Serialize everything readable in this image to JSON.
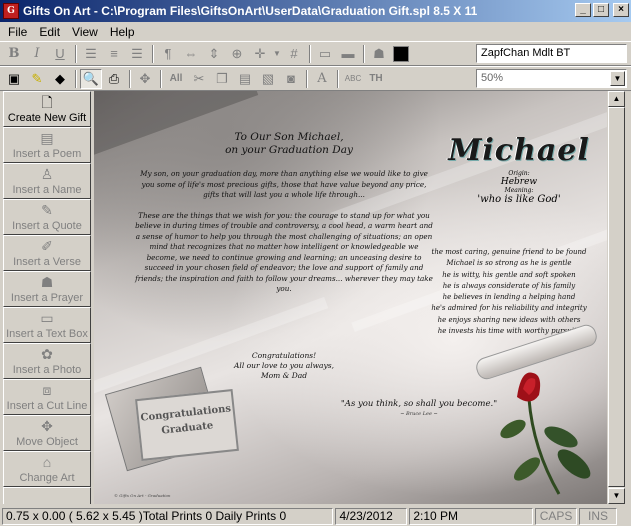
{
  "window": {
    "title": "Gifts On Art - C:\\Program Files\\GiftsOnArt\\UserData\\Graduation Gift.spl 8.5 X 11",
    "app_icon_letter": "G",
    "minimize": "_",
    "maximize": "□",
    "close": "×"
  },
  "menu": [
    "File",
    "Edit",
    "View",
    "Help"
  ],
  "toolbar": {
    "font_name": "ZapfChan Mdlt BT",
    "zoom": "50%"
  },
  "sidebar": [
    {
      "label": "Create New Gift",
      "icon": "new-document-icon",
      "glyph": "🗋",
      "enabled": true
    },
    {
      "label": "Insert a Poem",
      "icon": "poem-icon",
      "glyph": "▤",
      "enabled": false
    },
    {
      "label": "Insert a Name",
      "icon": "person-icon",
      "glyph": "♙",
      "enabled": false
    },
    {
      "label": "Insert a Quote",
      "icon": "quote-icon",
      "glyph": "✎",
      "enabled": false
    },
    {
      "label": "Insert a Verse",
      "icon": "verse-icon",
      "glyph": "✐",
      "enabled": false
    },
    {
      "label": "Insert a Prayer",
      "icon": "prayer-icon",
      "glyph": "☗",
      "enabled": false
    },
    {
      "label": "Insert a Text Box",
      "icon": "textbox-icon",
      "glyph": "▭",
      "enabled": false
    },
    {
      "label": "Insert a Photo",
      "icon": "photo-icon",
      "glyph": "✿",
      "enabled": false
    },
    {
      "label": "Insert a Cut Line",
      "icon": "cut-line-icon",
      "glyph": "⧈",
      "enabled": false
    },
    {
      "label": "Move Object",
      "icon": "move-icon",
      "glyph": "✥",
      "enabled": false
    },
    {
      "label": "Change Art",
      "icon": "art-icon",
      "glyph": "⌂",
      "enabled": false
    },
    {
      "label": "",
      "icon": "more-icon",
      "glyph": "✂",
      "enabled": false
    }
  ],
  "canvas": {
    "poem_title": [
      "To Our Son Michael,",
      "on your Graduation Day"
    ],
    "poem_paragraphs": [
      "My son, on your graduation day, more than anything else we would like to give you some of life's most precious gifts, those that have value beyond any price, gifts that will last you a whole life through...",
      "These are the things that we wish for you: the courage to stand up for what you believe in during times of trouble and controversy, a cool head, a warm heart and a sense of humor to help you through the most challenging of situations; an open mind that recognizes that no matter how intelligent or knowledgeable we become, we need to continue growing and learning; an unceasing desire to succeed in your chosen field of endeavor; the love and support of family and friends; the inspiration and faith to follow your dreams... wherever they may take you."
    ],
    "poem_closing": [
      "Congratulations!",
      "All our love to you always,",
      "Mom & Dad"
    ],
    "quote": "\"As you think, so shall you become.\"",
    "quote_author": "~ Bruce Lee ~",
    "name": "Michael",
    "origin_label": "Origin:",
    "origin": "Hebrew",
    "meaning_label": "Meaning:",
    "meaning": "'who is like God'",
    "name_poem": [
      "the most caring, genuine friend to be found",
      "Michael is so strong as he is gentle",
      "he is witty, his gentle and soft spoken",
      "he is always considerate of his family",
      "he believes in lending a helping hand",
      "he's admired for his reliability and integrity",
      "he enjoys sharing new ideas with others",
      "he invests his time with worthy pursuits"
    ],
    "card_text": [
      "Congratulations",
      "Graduate"
    ],
    "credit": "© Gifts On Art - Graduation"
  },
  "status": {
    "main": "0.75 x 0.00 ( 5.62 x 5.45 )Total Prints 0 Daily Prints 0",
    "date": "4/23/2012",
    "time": "2:10 PM",
    "caps": "CAPS",
    "ins": "INS"
  }
}
